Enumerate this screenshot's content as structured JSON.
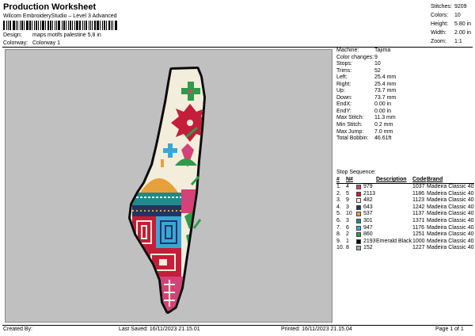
{
  "header": {
    "title": "Production Worksheet",
    "subtitle": "Wilcom EmbroideryStudio – Level 3 Advanced",
    "design_label": "Design:",
    "design_value": "maps motifs palestine 5,8 in",
    "colorway_label": "Colorway:",
    "colorway_value": "Colorway 1"
  },
  "top_stats": [
    {
      "label": "Stitches:",
      "value": "9209"
    },
    {
      "label": "Colors:",
      "value": "10"
    },
    {
      "label": "Height:",
      "value": "5.80 in"
    },
    {
      "label": "Width:",
      "value": "2.00 in"
    },
    {
      "label": "Zoom:",
      "value": "1:1"
    }
  ],
  "machine_info": [
    {
      "label": "Machine:",
      "value": "Tajima"
    },
    {
      "label": "Color changes:",
      "value": "9"
    },
    {
      "label": "Stops:",
      "value": "10"
    },
    {
      "label": "Trims:",
      "value": "52"
    },
    {
      "label": "Left:",
      "value": "25.4 mm"
    },
    {
      "label": "Right:",
      "value": "25.4 mm"
    },
    {
      "label": "Up:",
      "value": "73.7 mm"
    },
    {
      "label": "Down:",
      "value": "73.7 mm"
    },
    {
      "label": "EndX:",
      "value": "0.00 in"
    },
    {
      "label": "EndY:",
      "value": "0.00 in"
    },
    {
      "label": "Max Stitch:",
      "value": "11.3 mm"
    },
    {
      "label": "Min Stitch:",
      "value": "0.2 mm"
    },
    {
      "label": "Max Jump:",
      "value": "7.0 mm"
    },
    {
      "label": "Total Bobbin:",
      "value": "46.61ft"
    }
  ],
  "stop_sequence": {
    "heading": "Stop Sequence:",
    "columns": {
      "hash": "#",
      "n": "N#",
      "desc": "Description",
      "code": "Code",
      "brand": "Brand"
    },
    "rows": [
      {
        "num": "1.",
        "n": "4",
        "color": "#d4427a",
        "name": "979",
        "desc": "",
        "code": "1037",
        "brand": "Madeira Classic 40"
      },
      {
        "num": "2.",
        "n": "5",
        "color": "#c41e3a",
        "name": "2113",
        "desc": "",
        "code": "1186",
        "brand": "Madeira Classic 40"
      },
      {
        "num": "3.",
        "n": "9",
        "color": "#f2eedb",
        "name": "482",
        "desc": "",
        "code": "1123",
        "brand": "Madeira Classic 40"
      },
      {
        "num": "4.",
        "n": "3",
        "color": "#23355e",
        "name": "643",
        "desc": "",
        "code": "1242",
        "brand": "Madeira Classic 40"
      },
      {
        "num": "5.",
        "n": "10",
        "color": "#e8a13a",
        "name": "537",
        "desc": "",
        "code": "1137",
        "brand": "Madeira Classic 40"
      },
      {
        "num": "6.",
        "n": "3",
        "color": "#1f8a8a",
        "name": "301",
        "desc": "",
        "code": "1371",
        "brand": "Madeira Classic 40"
      },
      {
        "num": "7.",
        "n": "6",
        "color": "#3aa6d8",
        "name": "947",
        "desc": "",
        "code": "1176",
        "brand": "Madeira Classic 40"
      },
      {
        "num": "8.",
        "n": "2",
        "color": "#2e9b4a",
        "name": "860",
        "desc": "",
        "code": "1251",
        "brand": "Madeira Classic 40"
      },
      {
        "num": "9.",
        "n": "1",
        "color": "#0a0a0a",
        "name": "2193",
        "desc": "Emerald Black",
        "code": "1000",
        "brand": "Madeira Classic 40"
      },
      {
        "num": "10.",
        "n": "8",
        "color": "#8fb3a6",
        "name": "152",
        "desc": "",
        "code": "1227",
        "brand": "Madeira Classic 40"
      }
    ]
  },
  "footer": {
    "created_by": "Created By:",
    "last_saved": "Last Saved: 16/11/2023 21.15.01",
    "printed": "Printed: 16/11/2023 21.15.04",
    "page": "Page 1 of 1"
  },
  "preview": {
    "icon": "embroidery-design-preview",
    "bg_color": "#c0c0c0",
    "outline_color": "#0a0a0a"
  }
}
